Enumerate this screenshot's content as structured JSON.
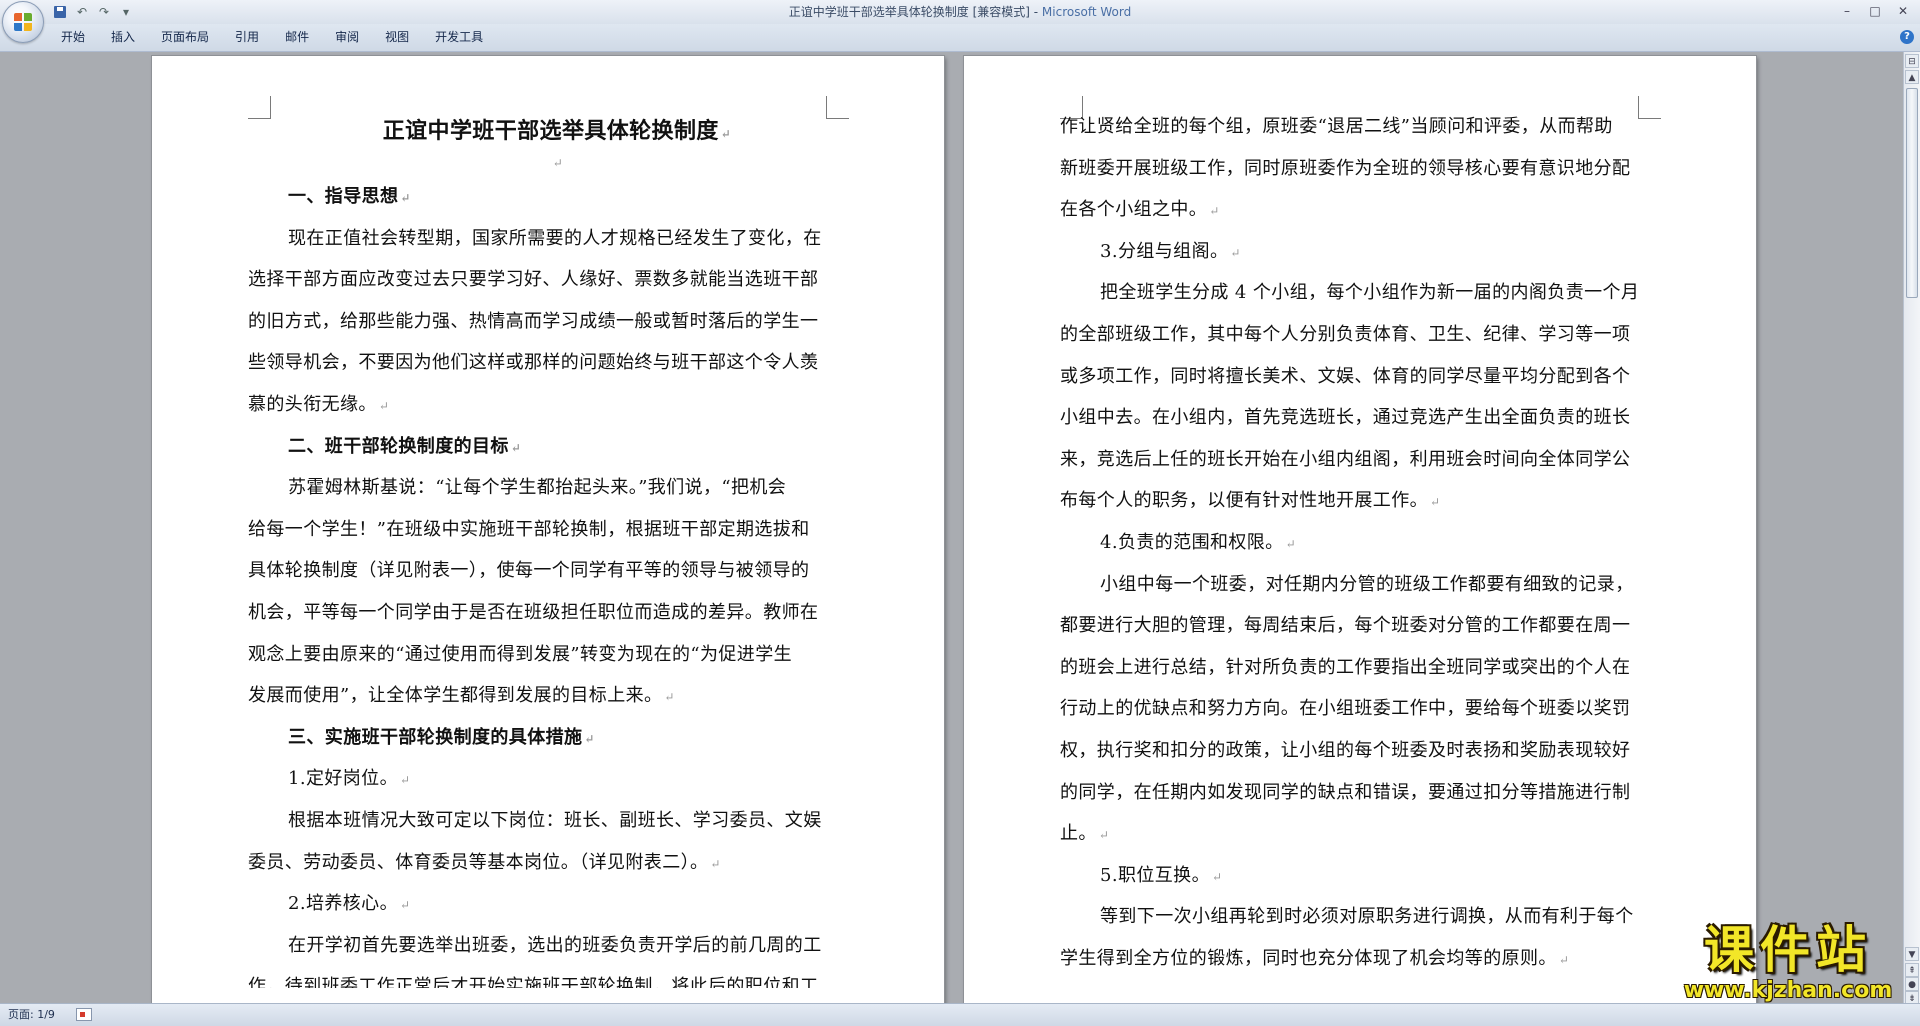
{
  "window": {
    "title_main": "正谊中学班干部选举具体轮换制度 [兼容模式] - ",
    "title_app": "Microsoft Word",
    "controls": {
      "minimize": "–",
      "maximize": "□",
      "close": "✕"
    }
  },
  "qat": {
    "undo": "↶",
    "redo": "↷",
    "more": "▾"
  },
  "ribbon": {
    "tabs": [
      "开始",
      "插入",
      "页面布局",
      "引用",
      "邮件",
      "审阅",
      "视图",
      "开发工具"
    ],
    "help": "?"
  },
  "page1": {
    "title": "正谊中学班干部选举具体轮换制度",
    "lines": [
      "一、指导思想",
      "现在正值社会转型期，国家所需要的人才规格已经发生了变化，在",
      "选择干部方面应改变过去只要学习好、人缘好、票数多就能当选班干部",
      "的旧方式，给那些能力强、热情高而学习成绩一般或暂时落后的学生一",
      "些领导机会，不要因为他们这样或那样的问题始终与班干部这个令人羡",
      "慕的头衔无缘。",
      "二、班干部轮换制度的目标",
      "苏霍姆林斯基说：“让每个学生都抬起头来。”我们说，“把机会",
      "给每一个学生！”在班级中实施班干部轮换制，根据班干部定期选拔和",
      "具体轮换制度（详见附表一），使每一个同学有平等的领导与被领导的",
      "机会，平等每一个同学由于是否在班级担任职位而造成的差异。教师在",
      "观念上要由原来的“通过使用而得到发展”转变为现在的“为促进学生",
      "发展而使用”，让全体学生都得到发展的目标上来。",
      "三、实施班干部轮换制度的具体措施",
      "1.定好岗位。",
      "根据本班情况大致可定以下岗位：班长、副班长、学习委员、文娱",
      "委员、劳动委员、体育委员等基本岗位。（详见附表二）。",
      "2.培养核心。",
      "在开学初首先要选举出班委，选出的班委负责开学后的前几周的工",
      "作，待到班委工作正常后才开始实施班干部轮换制，将此后的职位和工"
    ]
  },
  "page2": {
    "lines": [
      "作让贤给全班的每个组，原班委“退居二线”当顾问和评委，从而帮助",
      "新班委开展班级工作，同时原班委作为全班的领导核心要有意识地分配",
      "在各个小组之中。",
      "3.分组与组阁。",
      "把全班学生分成 4 个小组，每个小组作为新一届的内阁负责一个月",
      "的全部班级工作，其中每个人分别负责体育、卫生、纪律、学习等一项",
      "或多项工作，同时将擅长美术、文娱、体育的同学尽量平均分配到各个",
      "小组中去。在小组内，首先竞选班长，通过竞选产生出全面负责的班长",
      "来，竞选后上任的班长开始在小组内组阁，利用班会时间向全体同学公",
      "布每个人的职务，以便有针对性地开展工作。",
      "4.负责的范围和权限。",
      "小组中每一个班委，对任期内分管的班级工作都要有细致的记录，",
      "都要进行大胆的管理，每周结束后，每个班委对分管的工作都要在周一",
      "的班会上进行总结，针对所负责的工作要指出全班同学或突出的个人在",
      "行动上的优缺点和努力方向。在小组班委工作中，要给每个班委以奖罚",
      "权，执行奖和扣分的政策，让小组的每个班委及时表扬和奖励表现较好",
      "的同学，在任期内如发现同学的缺点和错误，要通过扣分等措施进行制",
      "止。",
      "5.职位互换。",
      "等到下一次小组再轮到时必须对原职务进行调换，从而有利于每个",
      "学生得到全方位的锻炼，同时也充分体现了机会均等的原则。"
    ]
  },
  "marks": {
    "paragraph": "↵"
  },
  "statusbar": {
    "page_info": "页面: 1/9"
  },
  "watermark": {
    "main": "课件站",
    "url": "www.kjzhan.com"
  }
}
